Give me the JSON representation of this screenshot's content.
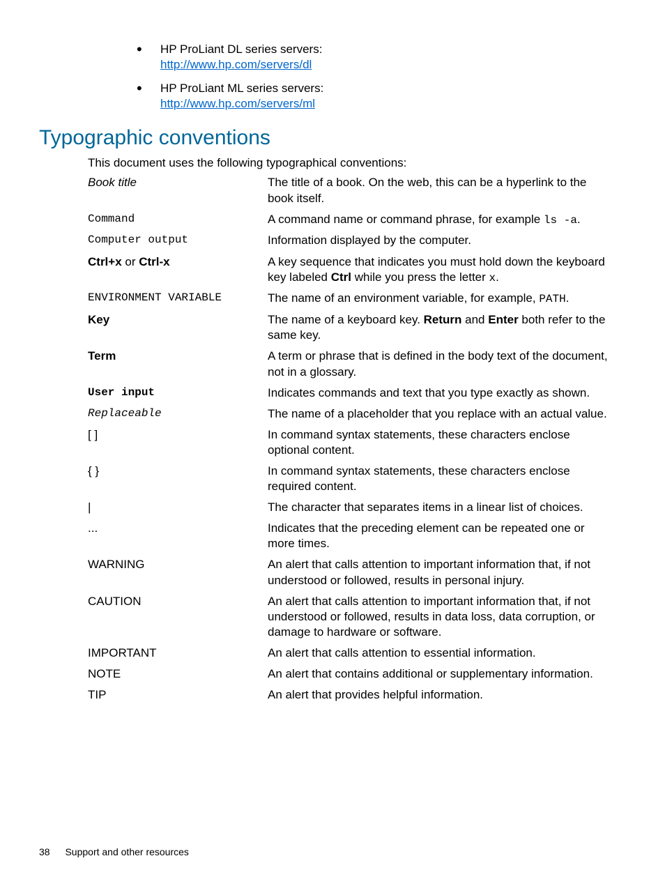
{
  "bullets": [
    {
      "text": "HP ProLiant DL series servers:",
      "url": "http://www.hp.com/servers/dl"
    },
    {
      "text": "HP ProLiant ML series servers:",
      "url": "http://www.hp.com/servers/ml"
    }
  ],
  "heading": "Typographic conventions",
  "intro": "This document uses the following typographical conventions:",
  "defs": {
    "book_title_term": "Book title",
    "book_title_desc": "The title of a book. On the web, this can be a hyperlink to the book itself.",
    "command_term": "Command",
    "command_desc_pre": "A command name or command phrase, for example ",
    "command_desc_code": "ls -a",
    "command_desc_post": ".",
    "computer_output_term": "Computer output",
    "computer_output_desc": "Information displayed by the computer.",
    "ctrl_term_a": "Ctrl+x",
    "ctrl_term_mid": " or ",
    "ctrl_term_b": "Ctrl-x",
    "ctrl_desc_pre": "A key sequence that indicates you must hold down the keyboard key labeled ",
    "ctrl_desc_key": "Ctrl",
    "ctrl_desc_mid": " while you press the letter ",
    "ctrl_desc_x": "x",
    "ctrl_desc_post": ".",
    "env_term": "ENVIRONMENT VARIABLE",
    "env_desc_pre": "The name of an environment variable, for example, ",
    "env_desc_code": "PATH",
    "env_desc_post": ".",
    "key_term": "Key",
    "key_desc_pre": "The name of a keyboard key. ",
    "key_desc_b1": "Return",
    "key_desc_mid": " and ",
    "key_desc_b2": "Enter",
    "key_desc_post": " both refer to the same key.",
    "term_term": "Term",
    "term_desc": "A term or phrase that is defined in the body text of the document, not in a glossary.",
    "user_input_term": "User input",
    "user_input_desc": "Indicates commands and text that you type exactly as shown.",
    "replaceable_term": "Replaceable",
    "replaceable_desc": "The name of a placeholder that you replace with an actual value.",
    "brackets_term": "[ ]",
    "brackets_desc": "In command syntax statements, these characters enclose optional content.",
    "braces_term": "{ }",
    "braces_desc": "In command syntax statements, these characters enclose required content.",
    "pipe_term": "|",
    "pipe_desc": "The character that separates items in a linear list of choices.",
    "ellipsis_term": "...",
    "ellipsis_desc": "Indicates that the preceding element can be repeated one or more times.",
    "warning_term": "WARNING",
    "warning_desc": "An alert that calls attention to important information that, if not understood or followed, results in personal injury.",
    "caution_term": "CAUTION",
    "caution_desc": "An alert that calls attention to important information that, if not understood or followed, results in data loss, data corruption, or damage to hardware or software.",
    "important_term": "IMPORTANT",
    "important_desc": "An alert that calls attention to essential information.",
    "note_term": "NOTE",
    "note_desc": "An alert that contains additional or supplementary information.",
    "tip_term": "TIP",
    "tip_desc": "An alert that provides helpful information."
  },
  "footer": {
    "page_number": "38",
    "section": "Support and other resources"
  }
}
